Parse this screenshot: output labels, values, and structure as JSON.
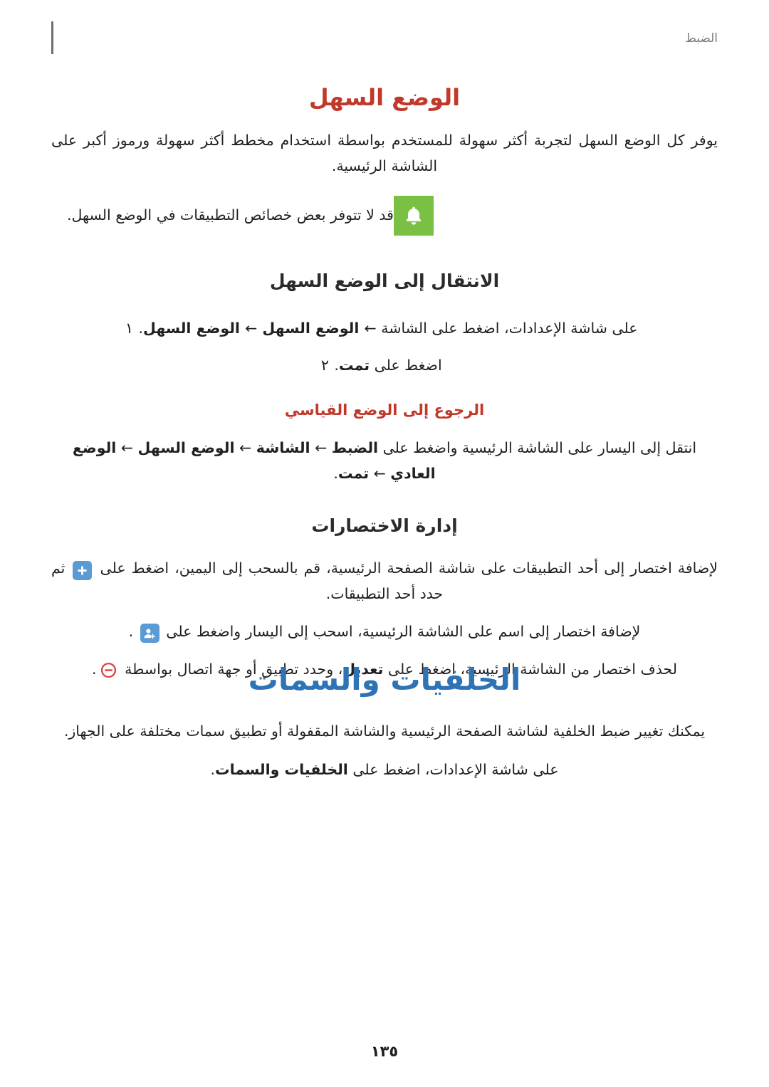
{
  "header": {
    "title": "الضبط"
  },
  "sections": {
    "easy_mode": {
      "title": "الوضع السهل",
      "intro": "يوفر كل الوضع السهل لتجربة أكثر سهولة للمستخدم بواسطة استخدام مخطط أكثر سهولة ورموز أكبر على الشاشة الرئيسية.",
      "note": "قد لا تتوفر بعض خصائص التطبيقات في الوضع السهل.",
      "switch_title": "الانتقال إلى الوضع السهل",
      "steps": [
        {
          "marker": "١",
          "text_parts": [
            {
              "t": "على شاشة الإعدادات، اضغط على الشاشة ",
              "b": false
            },
            {
              "t": "←",
              "b": false
            },
            {
              "t": " الوضع السهل ",
              "b": true
            },
            {
              "t": "←",
              "b": false
            },
            {
              "t": " الوضع السهل",
              "b": true
            },
            {
              "t": ".",
              "b": false
            }
          ]
        },
        {
          "marker": "٢",
          "text_parts": [
            {
              "t": "اضغط على ",
              "b": false
            },
            {
              "t": "تمت",
              "b": true
            },
            {
              "t": ".",
              "b": false
            }
          ]
        }
      ],
      "return_title": "الرجوع إلى الوضع القياسي",
      "return_text_parts": [
        {
          "t": "انتقل إلى اليسار  على الشاشة الرئيسية واضغط على ",
          "b": false
        },
        {
          "t": "الضبط",
          "b": true
        },
        {
          "t": " ← ",
          "b": false
        },
        {
          "t": "الشاشة",
          "b": true
        },
        {
          "t": " ← ",
          "b": false
        },
        {
          "t": "الوضع السهل",
          "b": true
        },
        {
          "t": " ← ",
          "b": false
        },
        {
          "t": "الوضع العادي",
          "b": true
        },
        {
          "t": " ← ",
          "b": false
        },
        {
          "t": "تمت",
          "b": true
        },
        {
          "t": ".",
          "b": false
        }
      ],
      "shortcuts_title": "إدارة الاختصارات",
      "shortcut_add_app": "لإضافة اختصار إلى أحد التطبيقات على شاشة الصفحة الرئيسية، قم بالسحب إلى اليمين، اضغط على {PLUS} ثم حدد أحد التطبيقات.",
      "shortcut_add_contact": "لإضافة اختصار إلى اسم على الشاشة الرئيسية، اسحب إلى اليسار واضغط على {USER} .",
      "shortcut_delete_parts": [
        {
          "t": "لحذف اختصار من الشاشة الرئيسية، اضغط على ",
          "b": false
        },
        {
          "t": "تعديل",
          "b": true
        },
        {
          "t": "، وحدد تطبيق أو جهة اتصال بواسطة ",
          "b": false
        },
        {
          "t": "{MINUS}",
          "b": false
        },
        {
          "t": ".",
          "b": false
        }
      ]
    },
    "wallpaper": {
      "title": "الخلفيات والسمات",
      "intro": "يمكنك تغيير  ضبط الخلفية لشاشة الصفحة الرئيسية والشاشة المقفولة أو تطبيق سمات مختلفة على الجهاز.",
      "line_parts": [
        {
          "t": "على شاشة الإعدادات، اضغط على ",
          "b": false
        },
        {
          "t": "الخلفيات والسمات",
          "b": true
        },
        {
          "t": ".",
          "b": false
        }
      ]
    }
  },
  "page_number": "١٣٥",
  "icons": {
    "note": "bell-icon",
    "plus": "plus-icon",
    "user": "add-contact-icon",
    "minus": "minus-circle-icon"
  },
  "colors": {
    "heading_red": "#c0392b",
    "heading_blue": "#2e74b5",
    "note_green": "#7ac143",
    "chip_blue": "#5b9bd5",
    "minus_red": "#e04040"
  }
}
